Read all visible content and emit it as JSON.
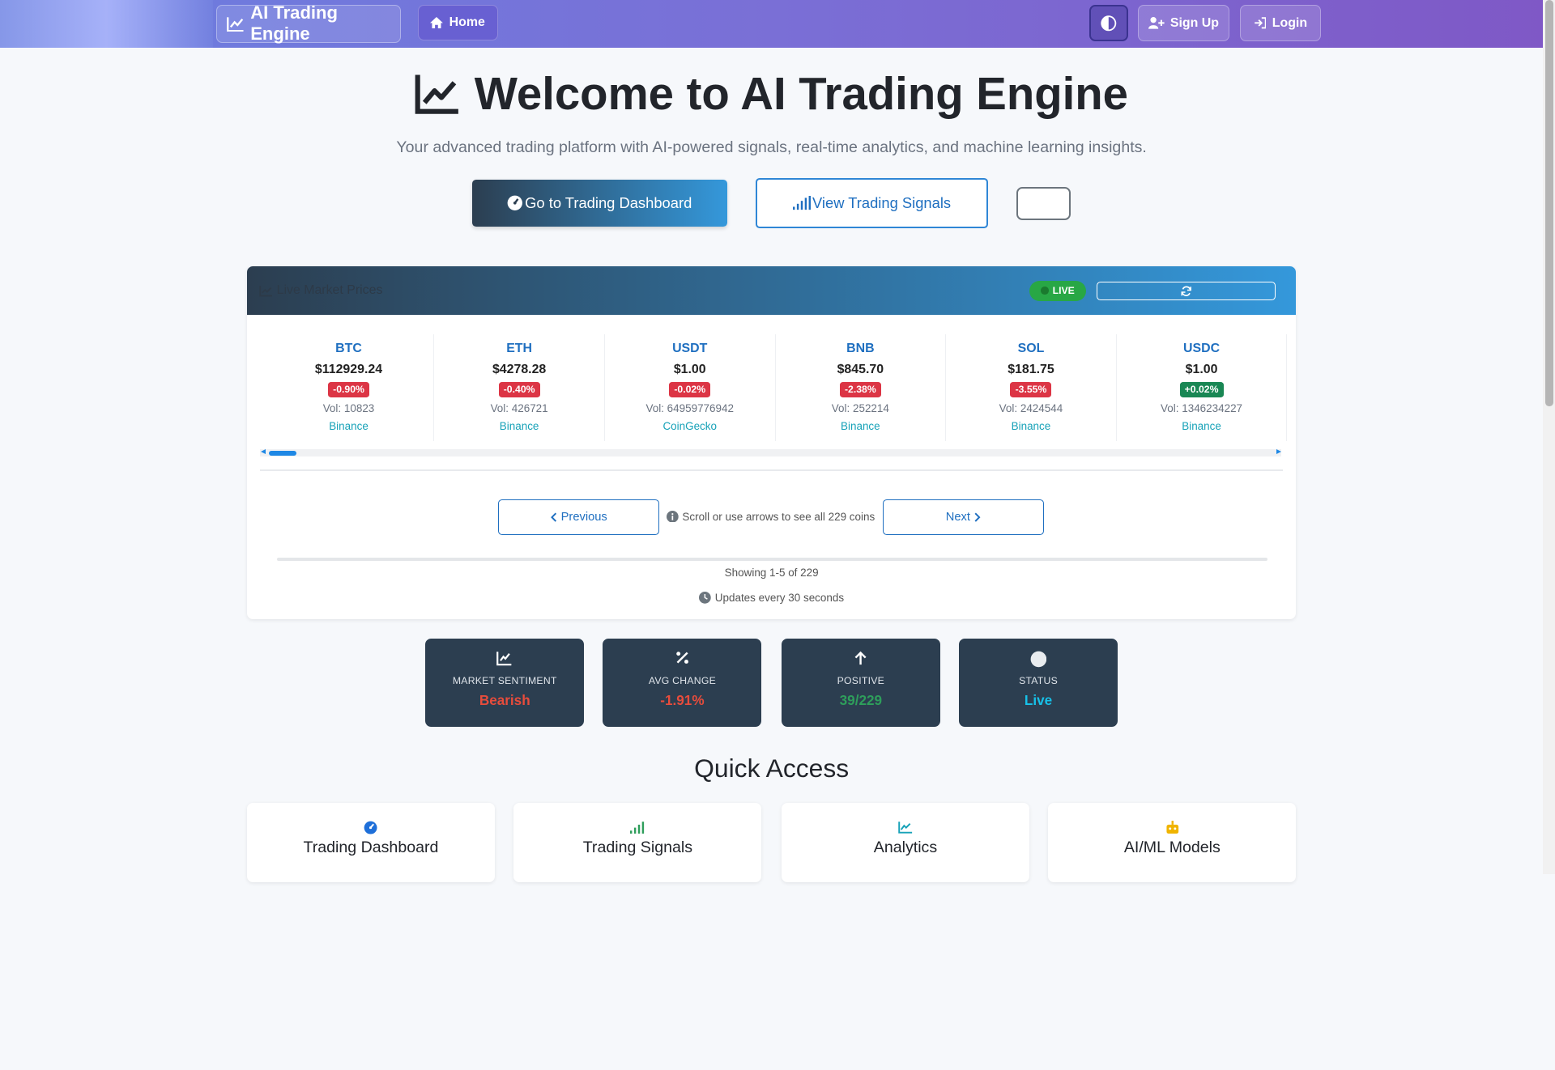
{
  "navbar": {
    "brand": "AI Trading Engine",
    "home": "Home",
    "signup": "Sign Up",
    "login": "Login"
  },
  "hero": {
    "title": "Welcome to AI Trading Engine",
    "subtitle": "Your advanced trading platform with AI-powered signals, real-time analytics, and machine learning insights.",
    "dashboard_btn": "Go to Trading Dashboard",
    "signals_btn": "View Trading Signals"
  },
  "market": {
    "title": "Live Market Prices",
    "live": "LIVE",
    "coins": [
      {
        "symbol": "BTC",
        "price": "$112929.24",
        "change": "-0.90%",
        "direction": "neg",
        "volume": "Vol: 10823",
        "source": "Binance"
      },
      {
        "symbol": "ETH",
        "price": "$4278.28",
        "change": "-0.40%",
        "direction": "neg",
        "volume": "Vol: 426721",
        "source": "Binance"
      },
      {
        "symbol": "USDT",
        "price": "$1.00",
        "change": "-0.02%",
        "direction": "neg",
        "volume": "Vol: 64959776942",
        "source": "CoinGecko"
      },
      {
        "symbol": "BNB",
        "price": "$845.70",
        "change": "-2.38%",
        "direction": "neg",
        "volume": "Vol: 252214",
        "source": "Binance"
      },
      {
        "symbol": "SOL",
        "price": "$181.75",
        "change": "-3.55%",
        "direction": "neg",
        "volume": "Vol: 2424544",
        "source": "Binance"
      },
      {
        "symbol": "USDC",
        "price": "$1.00",
        "change": "+0.02%",
        "direction": "pos",
        "volume": "Vol: 1346234227",
        "source": "Binance"
      }
    ],
    "previous": "Previous",
    "next": "Next",
    "hint": "Scroll or use arrows to see all 229 coins",
    "showing": "Showing 1-5 of 229",
    "updates": "Updates every 30 seconds"
  },
  "stats": [
    {
      "label": "MARKET SENTIMENT",
      "value": "Bearish",
      "color": "#e74c3c",
      "icon": "chart-line-icon"
    },
    {
      "label": "AVG CHANGE",
      "value": "-1.91%",
      "color": "#e74c3c",
      "icon": "percent-icon"
    },
    {
      "label": "POSITIVE",
      "value": "39/229",
      "color": "#2e9e5b",
      "icon": "arrow-up-icon"
    },
    {
      "label": "STATUS",
      "value": "Live",
      "color": "#17c1e8",
      "icon": "circle-icon"
    }
  ],
  "quick_access": {
    "title": "Quick Access",
    "cards": [
      {
        "name": "Trading Dashboard",
        "icon": "dashboard-icon"
      },
      {
        "name": "Trading Signals",
        "icon": "signal-icon"
      },
      {
        "name": "Analytics",
        "icon": "chart-line-icon"
      },
      {
        "name": "AI/ML Models",
        "icon": "robot-icon"
      }
    ]
  }
}
